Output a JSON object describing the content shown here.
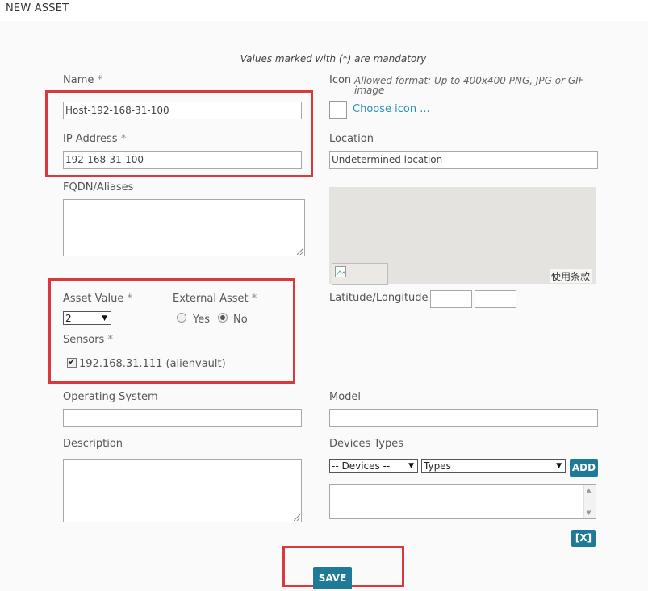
{
  "page": {
    "title": "NEW ASSET",
    "mandatory_note": "Values marked with (*) are mandatory"
  },
  "form": {
    "name": {
      "label": "Name",
      "required": "*",
      "value": "Host-192-168-31-100"
    },
    "ip": {
      "label": "IP Address",
      "required": "*",
      "value": "192-168-31-100"
    },
    "fqdn": {
      "label": "FQDN/Aliases",
      "value": ""
    },
    "icon": {
      "label": "Icon",
      "hint": "Allowed format: Up to 400x400 PNG, JPG or GIF image",
      "choose_link": "Choose icon ..."
    },
    "location": {
      "label": "Location",
      "value": "Undetermined location"
    },
    "map": {
      "terms": "使用条款"
    },
    "latlng": {
      "label": "Latitude/Longitude",
      "lat": "",
      "lng": ""
    },
    "asset_value": {
      "label": "Asset Value",
      "required": "*",
      "value": "2"
    },
    "external": {
      "label": "External Asset",
      "required": "*",
      "yes": "Yes",
      "no": "No",
      "selected": "No"
    },
    "sensors": {
      "label": "Sensors",
      "required": "*",
      "items": [
        {
          "label": "192.168.31.111 (alienvault)",
          "checked": true
        }
      ]
    },
    "os": {
      "label": "Operating System",
      "value": ""
    },
    "model": {
      "label": "Model",
      "value": ""
    },
    "description": {
      "label": "Description",
      "value": ""
    },
    "devices": {
      "label": "Devices Types",
      "device_select": "-- Devices --",
      "type_select": "Types",
      "add_label": "ADD",
      "remove_label": "[X]"
    },
    "save_label": "SAVE"
  },
  "colors": {
    "highlight": "#d9393c",
    "button": "#1e7a96",
    "link": "#2a8fbd"
  }
}
